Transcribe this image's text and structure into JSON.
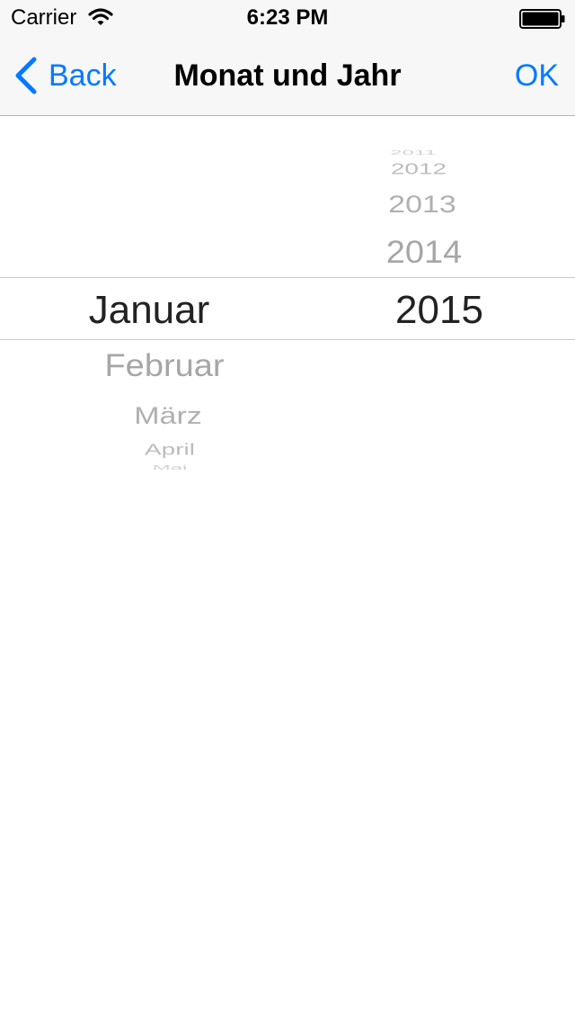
{
  "status_bar": {
    "carrier": "Carrier",
    "time": "6:23 PM",
    "wifi_icon": "wifi-icon",
    "battery_icon": "battery-icon"
  },
  "nav_bar": {
    "back_label": "Back",
    "back_icon": "chevron-left-icon",
    "title": "Monat und Jahr",
    "ok_label": "OK",
    "accent_color": "#007aff"
  },
  "picker": {
    "months": {
      "selected": "Januar",
      "below": [
        "Februar",
        "März",
        "April",
        "Mai"
      ]
    },
    "years": {
      "above": [
        "2011",
        "2012",
        "2013",
        "2014"
      ],
      "selected": "2015"
    }
  }
}
